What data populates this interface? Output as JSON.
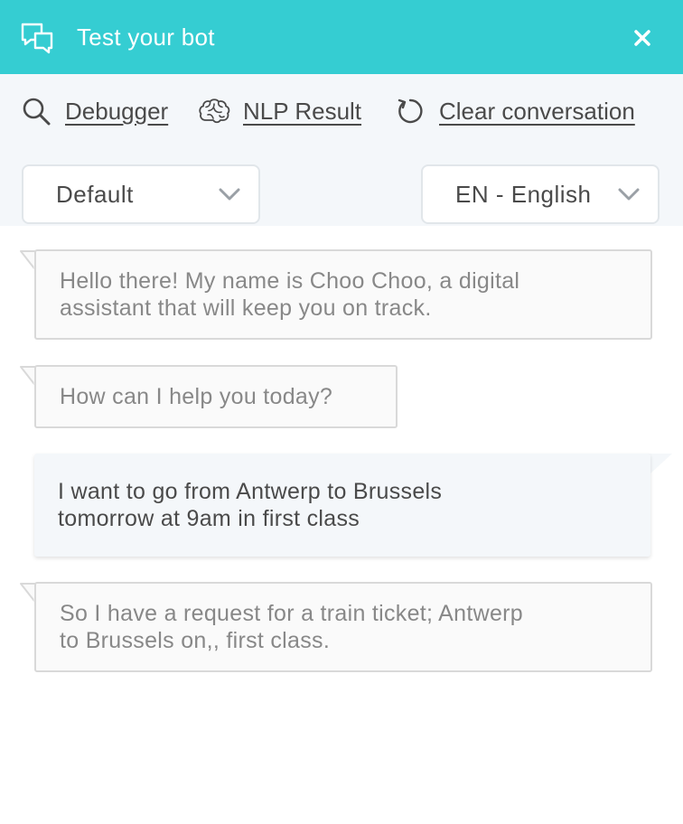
{
  "header": {
    "title": "Test your bot",
    "icon": "chat-bubbles-icon",
    "close_icon": "close-icon",
    "background": "#35cdd2"
  },
  "toolbar": {
    "debugger_label": "Debugger",
    "nlp_label": "NLP Result",
    "clear_label": "Clear conversation"
  },
  "selects": {
    "story": "Default",
    "language": "EN - English"
  },
  "messages": [
    {
      "from": "bot",
      "text": "Hello there! My name is Choo Choo, a digital\nassistant that will keep you on track."
    },
    {
      "from": "bot",
      "text": "How can I help you today?"
    },
    {
      "from": "user",
      "text": "I want to go from Antwerp to Brussels\ntomorrow at 9am in first class"
    },
    {
      "from": "bot",
      "text": "So I have a request for a train ticket; Antwerp\nto Brussels on,, first class."
    }
  ]
}
